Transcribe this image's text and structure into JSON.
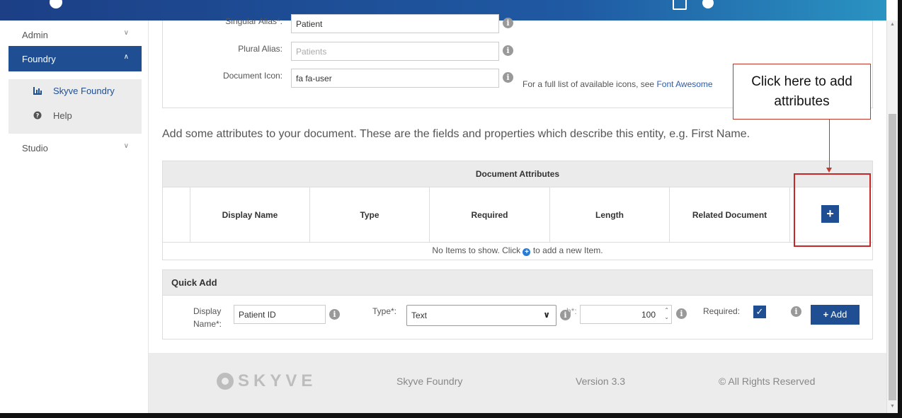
{
  "sidebar": {
    "items": [
      {
        "label": "Admin"
      },
      {
        "label": "Foundry"
      },
      {
        "label": "Studio"
      }
    ],
    "submenu": [
      {
        "label": "Skyve Foundry",
        "icon": "chart-icon"
      },
      {
        "label": "Help",
        "icon": "question-icon"
      }
    ]
  },
  "form": {
    "singular_label": "Singular Alias*:",
    "singular_value": "Patient",
    "plural_label": "Plural Alias:",
    "plural_placeholder": "Patients",
    "icon_label": "Document Icon:",
    "icon_value": "fa fa-user",
    "icon_hint_prefix": "For a full list of available icons, see",
    "icon_hint_link": "Font Awesome"
  },
  "intro_text": "Add some attributes to your document. These are the fields and properties which describe this entity, e.g. First Name.",
  "attributes_grid": {
    "title": "Document Attributes",
    "columns": [
      "Display Name",
      "Type",
      "Required",
      "Length",
      "Related Document"
    ],
    "add_button": "+",
    "empty_prefix": "No Items to show. Click",
    "empty_suffix": "to add a new Item."
  },
  "quick_add": {
    "title": "Quick Add",
    "display_name_label_1": "Display",
    "display_name_label_2": "Name*:",
    "display_name_value": "Patient ID",
    "type_label": "Type*:",
    "type_value": "Text",
    "length_label_partial": "h*:",
    "length_value": "100",
    "required_label": "Required:",
    "add_label": "Add"
  },
  "footer": {
    "logo": "SKYVE",
    "product": "Skyve Foundry",
    "version": "Version 3.3",
    "rights": "© All Rights Reserved"
  },
  "callout": {
    "line1": "Click here to add",
    "line2": "attributes"
  },
  "colors": {
    "primary": "#1f4f92",
    "annotation": "#c62828"
  }
}
